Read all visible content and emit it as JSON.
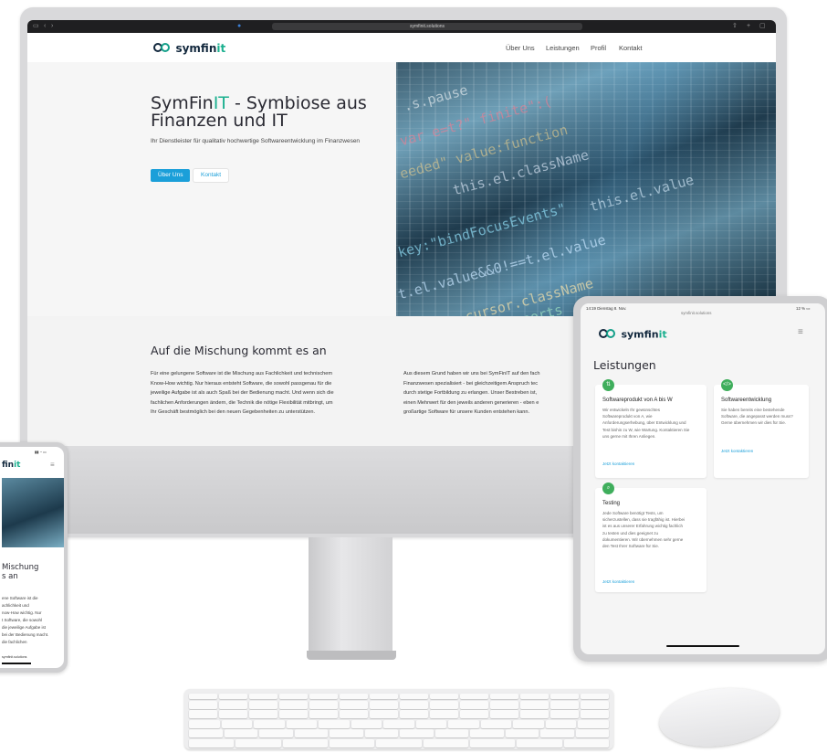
{
  "browser": {
    "url": "symfinit.solutions"
  },
  "brand": {
    "name_main": "symfin",
    "name_accent": "it"
  },
  "nav": {
    "items": [
      "Über Uns",
      "Leistungen",
      "Profil",
      "Kontakt"
    ]
  },
  "hero": {
    "title_a": "SymFin",
    "title_accent": "IT",
    "title_b": " - Symbiose aus",
    "title_line2": "Finanzen und IT",
    "subtitle": "Ihr Dienstleister für qualitativ hochwertige Softwareentwicklung im Finanzwesen",
    "btn_primary": "Über Uns",
    "btn_secondary": "Kontakt",
    "code_lines": [
      ".s.pause",
      "var e=t?\" finite\":(",
      "eeded\" value:function",
      "this.el.className",
      "this.el.value",
      "key:\"bindFocusEvents\"",
      "t.el.value&&0!==t.el.value",
      "this.cursor.className",
      "fault\"]=a,c.exports"
    ]
  },
  "about": {
    "title": "Auf die Mischung kommt es an",
    "col1": [
      "Für eine gelungene Software ist die Mischung aus Fachlichkeit und technischem",
      "Know-How wichtig. Nur hieraus entsteht Software, die sowohl passgenau für die",
      "jeweilige Aufgabe ist als auch Spaß bei der Bedienung macht. Und wenn sich die",
      "fachlichen Anforderungen ändern, die Technik die nötige Flexibilität mitbringt, um",
      "Ihr Geschäft bestmöglich bei den neuen Gegebenheiten zu unterstützen."
    ],
    "col2": [
      "Aus diesem Grund haben wir uns bei SymFinIT auf den fach",
      "Finanzwesen spezialisiert - bei gleichzeitigem Anspruch tec",
      "durch stetige Fortbildung zu erlangen. Unser Bestreben ist,",
      "einen Mehrwert für den jeweils anderen generieren - eben e",
      "großartige Software für unsere Kunden entstehen kann."
    ]
  },
  "tablet": {
    "status_time": "14:19  Dienstag 8. Nov.",
    "status_url": "symfinit.solutions",
    "status_right": "12 % ▭",
    "section_title": "Leistungen",
    "cards": [
      {
        "icon": "⇅",
        "icon_name": "arrows-icon",
        "title": "Softwareprodukt von A bis W",
        "text": "Wir entwickeln Ihr gewünschtes Softwareprodukt von A, wie Anforderungserhebung, über Entwicklung und Test bishin zu W, wie Wartung. Kontaktieren Sie uns gerne mit Ihren Anliegen.",
        "link": "Jetzt kontaktieren"
      },
      {
        "icon": "</>",
        "icon_name": "code-icon",
        "title": "Softwareentwicklung",
        "text": "Sie haben bereits eine bestehende Software, die angepasst werden muss? Gerne übernehmen wir dies für Sie.",
        "link": "Jetzt kontaktieren"
      },
      {
        "icon": "⌕",
        "icon_name": "search-icon",
        "title": "Testing",
        "text": "Jede Software benötigt Tests, um sicherzustellen, dass sie tragfähig ist. Hierbei ist es aus unserer Erfahrung wichtig fachlich zu testen und dies geeignet zu dokumentieren. Wir übernehmen sehr gerne den Test Ihrer Software für Sie.",
        "link": "Jetzt kontaktieren"
      }
    ]
  },
  "phone": {
    "brand_partial": "fin",
    "brand_accent": "it",
    "title_line1": "Mischung",
    "title_line2": "s an",
    "body": [
      "ene Software ist die",
      "achlichkeit und",
      "now-How wichtig. Nur",
      "t Software, die sowohl",
      "die jeweilige Aufgabe ist",
      "bei der Bedienung macht.",
      "die fachlichen"
    ],
    "url": "symfinit.solutions"
  },
  "colors": {
    "brand_dark": "#12283d",
    "brand_green": "#1bb08f",
    "accent_blue": "#1b9fd9",
    "icon_green": "#3fae5c"
  }
}
